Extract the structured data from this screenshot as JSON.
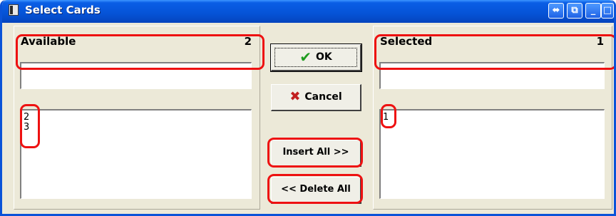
{
  "window": {
    "title": "Select Cards",
    "buttons": [
      "restore-left-right",
      "switch-window",
      "minimize",
      "maximize",
      "close"
    ]
  },
  "available": {
    "label": "Available",
    "count": "2",
    "filter_value": "",
    "items": [
      "2",
      "3"
    ]
  },
  "selected": {
    "label": "Selected",
    "count": "1",
    "filter_value": "",
    "items": [
      "1"
    ]
  },
  "actions": {
    "ok": "OK",
    "cancel": "Cancel",
    "insert_all": "Insert All >>",
    "delete_all": "<< Delete All"
  },
  "colors": {
    "titlebar": "#0553d6",
    "window_bg": "#ece9d8",
    "annotation": "#ee1111",
    "ok_check": "#1f9c1f",
    "cancel_x": "#c21f1f"
  }
}
